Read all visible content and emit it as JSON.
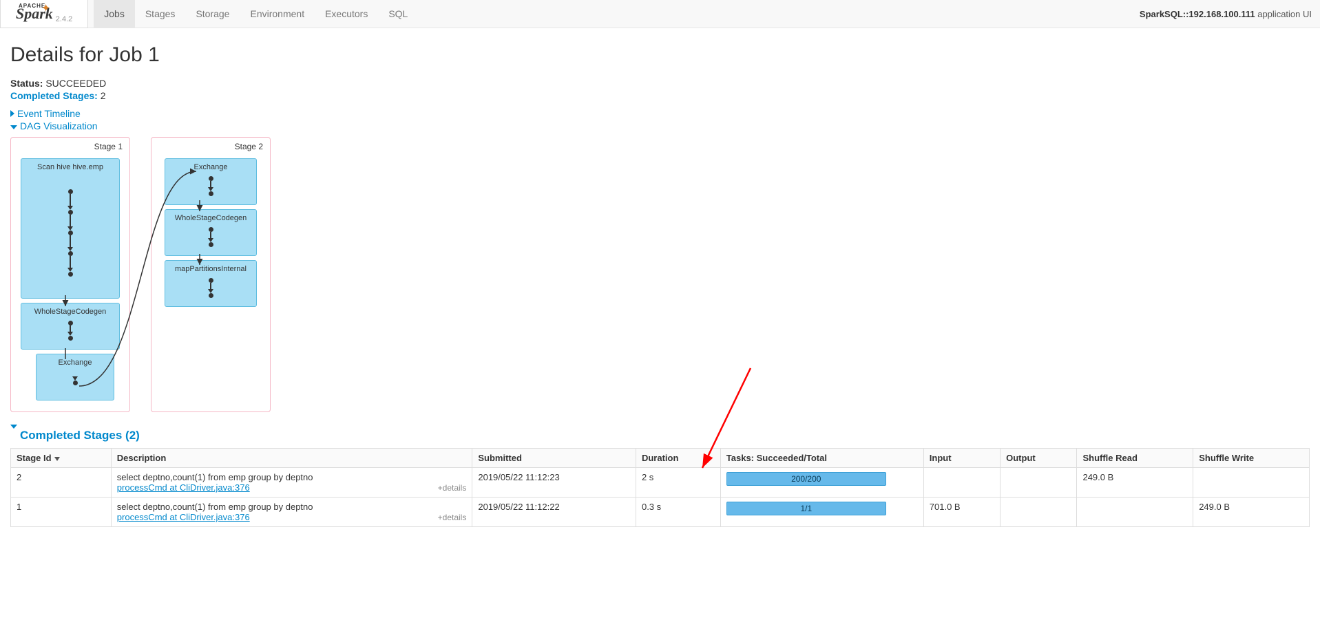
{
  "brand": {
    "apache": "APACHE",
    "name": "Spark",
    "version": "2.4.2"
  },
  "nav": {
    "tabs": [
      {
        "label": "Jobs",
        "active": true
      },
      {
        "label": "Stages",
        "active": false
      },
      {
        "label": "Storage",
        "active": false
      },
      {
        "label": "Environment",
        "active": false
      },
      {
        "label": "Executors",
        "active": false
      },
      {
        "label": "SQL",
        "active": false
      }
    ],
    "app_title_strong": "SparkSQL::192.168.100.111",
    "app_title_suffix": " application UI"
  },
  "page": {
    "title": "Details for Job 1",
    "status_label": "Status:",
    "status_value": "SUCCEEDED",
    "completed_stages_label": "Completed Stages:",
    "completed_stages_value": "2",
    "event_timeline": "Event Timeline",
    "dag_viz": "DAG Visualization"
  },
  "dag": {
    "stage1": {
      "label": "Stage 1",
      "ops": [
        {
          "name": "Scan hive hive.emp"
        },
        {
          "name": "WholeStageCodegen"
        },
        {
          "name": "Exchange"
        }
      ]
    },
    "stage2": {
      "label": "Stage 2",
      "ops": [
        {
          "name": "Exchange"
        },
        {
          "name": "WholeStageCodegen"
        },
        {
          "name": "mapPartitionsInternal"
        }
      ]
    }
  },
  "section": {
    "completed_stages_header": "Completed Stages (2)"
  },
  "table": {
    "headers": {
      "stage_id": "Stage Id",
      "description": "Description",
      "submitted": "Submitted",
      "duration": "Duration",
      "tasks": "Tasks: Succeeded/Total",
      "input": "Input",
      "output": "Output",
      "shuffle_read": "Shuffle Read",
      "shuffle_write": "Shuffle Write"
    },
    "details_link": "+details",
    "rows": [
      {
        "id": "2",
        "desc_top": "select deptno,count(1) from emp group by deptno",
        "desc_link": "processCmd at CliDriver.java:376",
        "submitted": "2019/05/22 11:12:23",
        "duration": "2 s",
        "tasks": "200/200",
        "input": "",
        "output": "",
        "shuffle_read": "249.0 B",
        "shuffle_write": ""
      },
      {
        "id": "1",
        "desc_top": "select deptno,count(1) from emp group by deptno",
        "desc_link": "processCmd at CliDriver.java:376",
        "submitted": "2019/05/22 11:12:22",
        "duration": "0.3 s",
        "tasks": "1/1",
        "input": "701.0 B",
        "output": "",
        "shuffle_read": "",
        "shuffle_write": "249.0 B"
      }
    ]
  }
}
